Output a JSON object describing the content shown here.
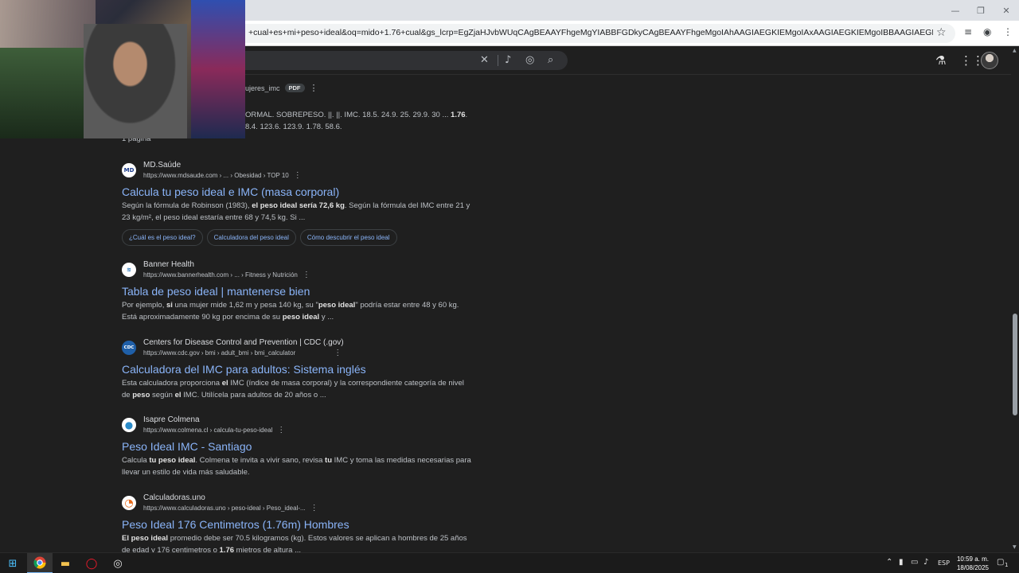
{
  "browser": {
    "url": "+cual+es+mi+peso+ideal&oq=mido+1.76+cual&gs_lcrp=EgZjaHJvbWUqCAgBEAAYFhgeMgYIABBFGDkyCAgBEAAYFhgeMgoIAhAAGIAEGKIEMgoIAxAAGIAEGKIEMgoIBBAAGIAEGKIEMgcIBRAAGO8F0gEINTk...",
    "star_icon": "star-icon",
    "win_minimize": "—",
    "win_restore": "❐",
    "win_close": "✕"
  },
  "search": {
    "clear_icon": "✕",
    "mic_icon": "🎤",
    "lens_icon": "◎",
    "search_icon": "⌕"
  },
  "partial_result": {
    "breadcrumb": "ujeres_imc",
    "badge": "PDF",
    "line1_pre": "ORMAL. SOBREPESO. ||. ||. IMC. 18.5. 24.9. 25. 29.9. 30 ... ",
    "line1_bold": "1.76",
    "line1_post": ".",
    "line2": "8.4. 123.6. 123.9. 1.78. 58.6.",
    "pages": "1 página"
  },
  "results": [
    {
      "site": "MD.Saúde",
      "url": "https://www.mdsaude.com › ... › Obesidad › TOP 10",
      "title": "Calcula tu peso ideal e IMC (masa corporal)",
      "s1": "Según la fórmula de Robinson (1983), ",
      "s2": "el peso ideal sería 72,6 kg",
      "s3": ". Según la fórmula del IMC entre 21 y 23 kg/m², el peso ideal estaría entre 68 y 74,5 kg. Si ...",
      "chips": [
        "¿Cuál es el peso ideal?",
        "Calculadora del peso ideal",
        "Cómo descubrir el peso ideal"
      ],
      "favicon": "MD",
      "favicon_color": "#ffffff",
      "favicon_text_color": "#1a3a8a"
    },
    {
      "site": "Banner Health",
      "url": "https://www.bannerhealth.com › ... › Fitness y Nutrición",
      "title": "Tabla de peso ideal | mantenerse bien",
      "s1": "Por ejemplo, ",
      "s2": "si",
      "s3": " una mujer mide 1,62 m y pesa 140 kg, su \"",
      "s4": "peso ideal",
      "s5": "\" podría estar entre 48 y 60 kg. Está aproximadamente 90 kg por encima de su ",
      "s6": "peso ideal",
      "s7": " y ...",
      "favicon": "≋",
      "favicon_color": "#ffffff",
      "favicon_text_color": "#1f6fb5"
    },
    {
      "site": "Centers for Disease Control and Prevention | CDC (.gov)",
      "url": "https://www.cdc.gov › bmi › adult_bmi › bmi_calculator",
      "title": "Calculadora del IMC para adultos: Sistema inglés",
      "s1": "Esta calculadora proporciona ",
      "s2": "el",
      "s3": " IMC (índice de masa corporal) y la correspondiente categoría de nivel de ",
      "s4": "peso",
      "s5": " según ",
      "s6": "el",
      "s7": " IMC. Utilícela para adultos de 20 años o ...",
      "favicon": "CDC",
      "favicon_color": "#1f5fa8",
      "favicon_text_color": "#ffffff"
    },
    {
      "site": "Isapre Colmena",
      "url": "https://www.colmena.cl › calcula-tu-peso-ideal",
      "title": "Peso Ideal IMC - Santiago",
      "s1": "Calcula ",
      "s2": "tu peso ideal",
      "s3": ". Colmena te invita a vivir sano, revisa ",
      "s4": "tu",
      "s5": " IMC y toma las medidas necesarias para llevar un estilo de vida más saludable.",
      "favicon": "●",
      "favicon_color": "#ffffff",
      "favicon_text_color": "#2a8ac8"
    },
    {
      "site": "Calculadoras.uno",
      "url": "https://www.calculadoras.uno › peso-ideal › Peso_ideal-...",
      "title": "Peso Ideal 176 Centimetros (1.76m) Hombres",
      "s1": "El peso ideal",
      "s2": " promedio debe ser 70.5 kilogramos (kg). Estos valores se aplican a hombres de 25 años de edad y 176 centimetros o ",
      "s3": "1.76",
      "s4": " mietros de altura ...",
      "favicon": "◔",
      "favicon_color": "#ffffff",
      "favicon_text_color": "#e86a1a"
    }
  ],
  "taskbar": {
    "language": "ESP",
    "time": "10:59 a. m.",
    "date": "18/08/2025",
    "notif_count": "1"
  }
}
